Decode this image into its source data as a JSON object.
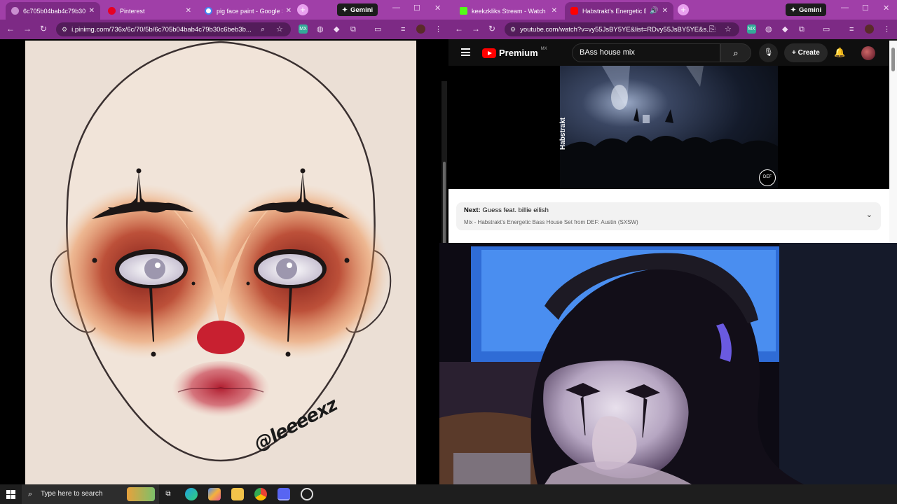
{
  "left_window": {
    "tabs": [
      {
        "title": "6c705b04bab4c79b30c6b",
        "active": true
      },
      {
        "title": "Pinterest",
        "active": false
      },
      {
        "title": "pig face paint - Google S",
        "active": false
      }
    ],
    "gemini_label": "Gemini",
    "url": "i.pinimg.com/736x/6c/70/5b/6c705b04bab4c79b30c6beb3b...",
    "image_watermark": "@leeeexz"
  },
  "right_window": {
    "tabs": [
      {
        "title": "keekzkliks Stream - Watch Live",
        "active": false
      },
      {
        "title": "Habstrakt's Energetic Bass",
        "active": true
      }
    ],
    "gemini_label": "Gemini",
    "url": "youtube.com/watch?v=vy55JsBY5YE&list=RDvy55JsBY5YE&s...",
    "youtube": {
      "logo_text": "Premium",
      "region_badge": "MX",
      "search_value": "BAss house mix",
      "create_label": "Create",
      "video_overlay_text": "Habstrakt",
      "video_corner_logo": "DEF",
      "next_prefix": "Next:",
      "next_title": "Guess feat. billie eilish",
      "next_playlist": "Mix - Habstrakt's Energetic Bass House Set from DEF: Austin (SXSW)"
    }
  },
  "taskbar": {
    "search_placeholder": "Type here to search"
  },
  "colors": {
    "browser_frame": "#a03fa8",
    "toolbar": "#7d2a85",
    "youtube_red": "#ff0000",
    "clown_red": "#c82030"
  }
}
